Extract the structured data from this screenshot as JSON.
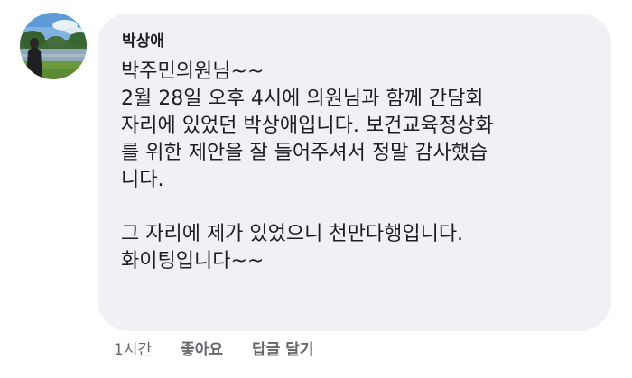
{
  "comment": {
    "author_name": "박상애",
    "text": "박주민의원님~~\n2월 28일 오후 4시에 의원님과 함께 간담회\n자리에 있었던 박상애입니다. 보건교육정상화\n를 위한 제안을 잘 들어주셔서 정말 감사했습\n니다.\n\n그 자리에 제가 있었으니 천만다행입니다.\n화이팅입니다~~",
    "timestamp": "1시간",
    "like_label": "좋아요",
    "reply_label": "답글 달기"
  }
}
